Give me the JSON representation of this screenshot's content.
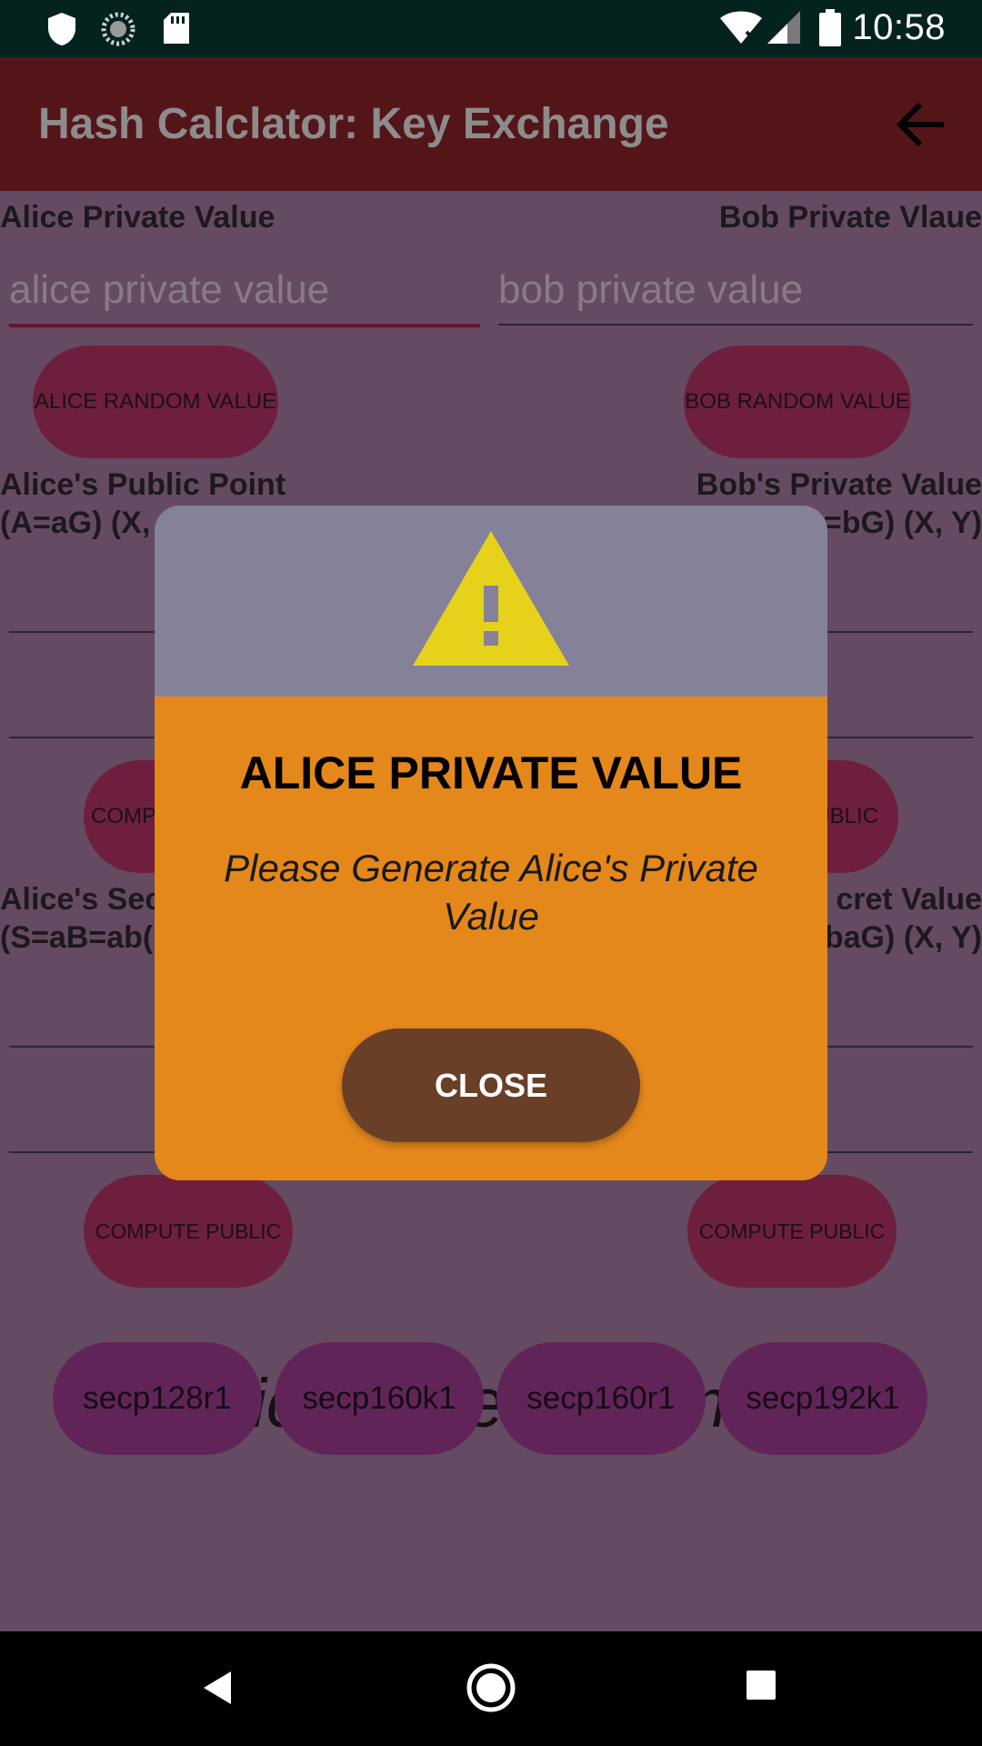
{
  "status_bar": {
    "time": "10:58",
    "icons": [
      "shield-icon",
      "sync-icon",
      "sd-card-icon",
      "wifi-icon",
      "signal-icon",
      "battery-icon"
    ]
  },
  "app_bar": {
    "title": "Hash Calclator: Key Exchange",
    "back_icon": "arrow-back-icon"
  },
  "alice": {
    "private_label": "Alice Private Value",
    "private_placeholder": "alice private value",
    "random_button": "ALICE RANDOM VALUE",
    "public_label_line1": "Alice's Public Point",
    "public_label_line2": "(A=aG) (X,",
    "compute_button_partial": "COMP",
    "secret_label_line1": "Alice's Sec",
    "secret_label_line2": "(S=aB=ab(",
    "compute_public_button": "COMPUTE PUBLIC"
  },
  "bob": {
    "private_label": "Bob Private Vlaue",
    "private_placeholder": "bob private value",
    "random_button": "BOB RANDOM VALUE",
    "public_label_line1": "Bob's Private Value",
    "public_label_line2": "=bG) (X, Y)",
    "compute_button_partial": "UBLIC",
    "secret_label_line1": "cret Value",
    "secret_label_line2": "baG) (X, Y)",
    "compute_public_button": "COMPUTE PUBLIC"
  },
  "curves": {
    "heading": "Elliptic Curve Parameters",
    "items": [
      "secp128r1",
      "secp160k1",
      "secp160r1",
      "secp192k1"
    ]
  },
  "dialog": {
    "icon": "warning-icon",
    "title": "ALICE PRIVATE VALUE",
    "message": "Please Generate Alice's Private Value",
    "close_button": "CLOSE"
  },
  "nav_bar": {
    "icons": [
      "back-triangle-icon",
      "home-circle-icon",
      "recents-square-icon"
    ]
  }
}
